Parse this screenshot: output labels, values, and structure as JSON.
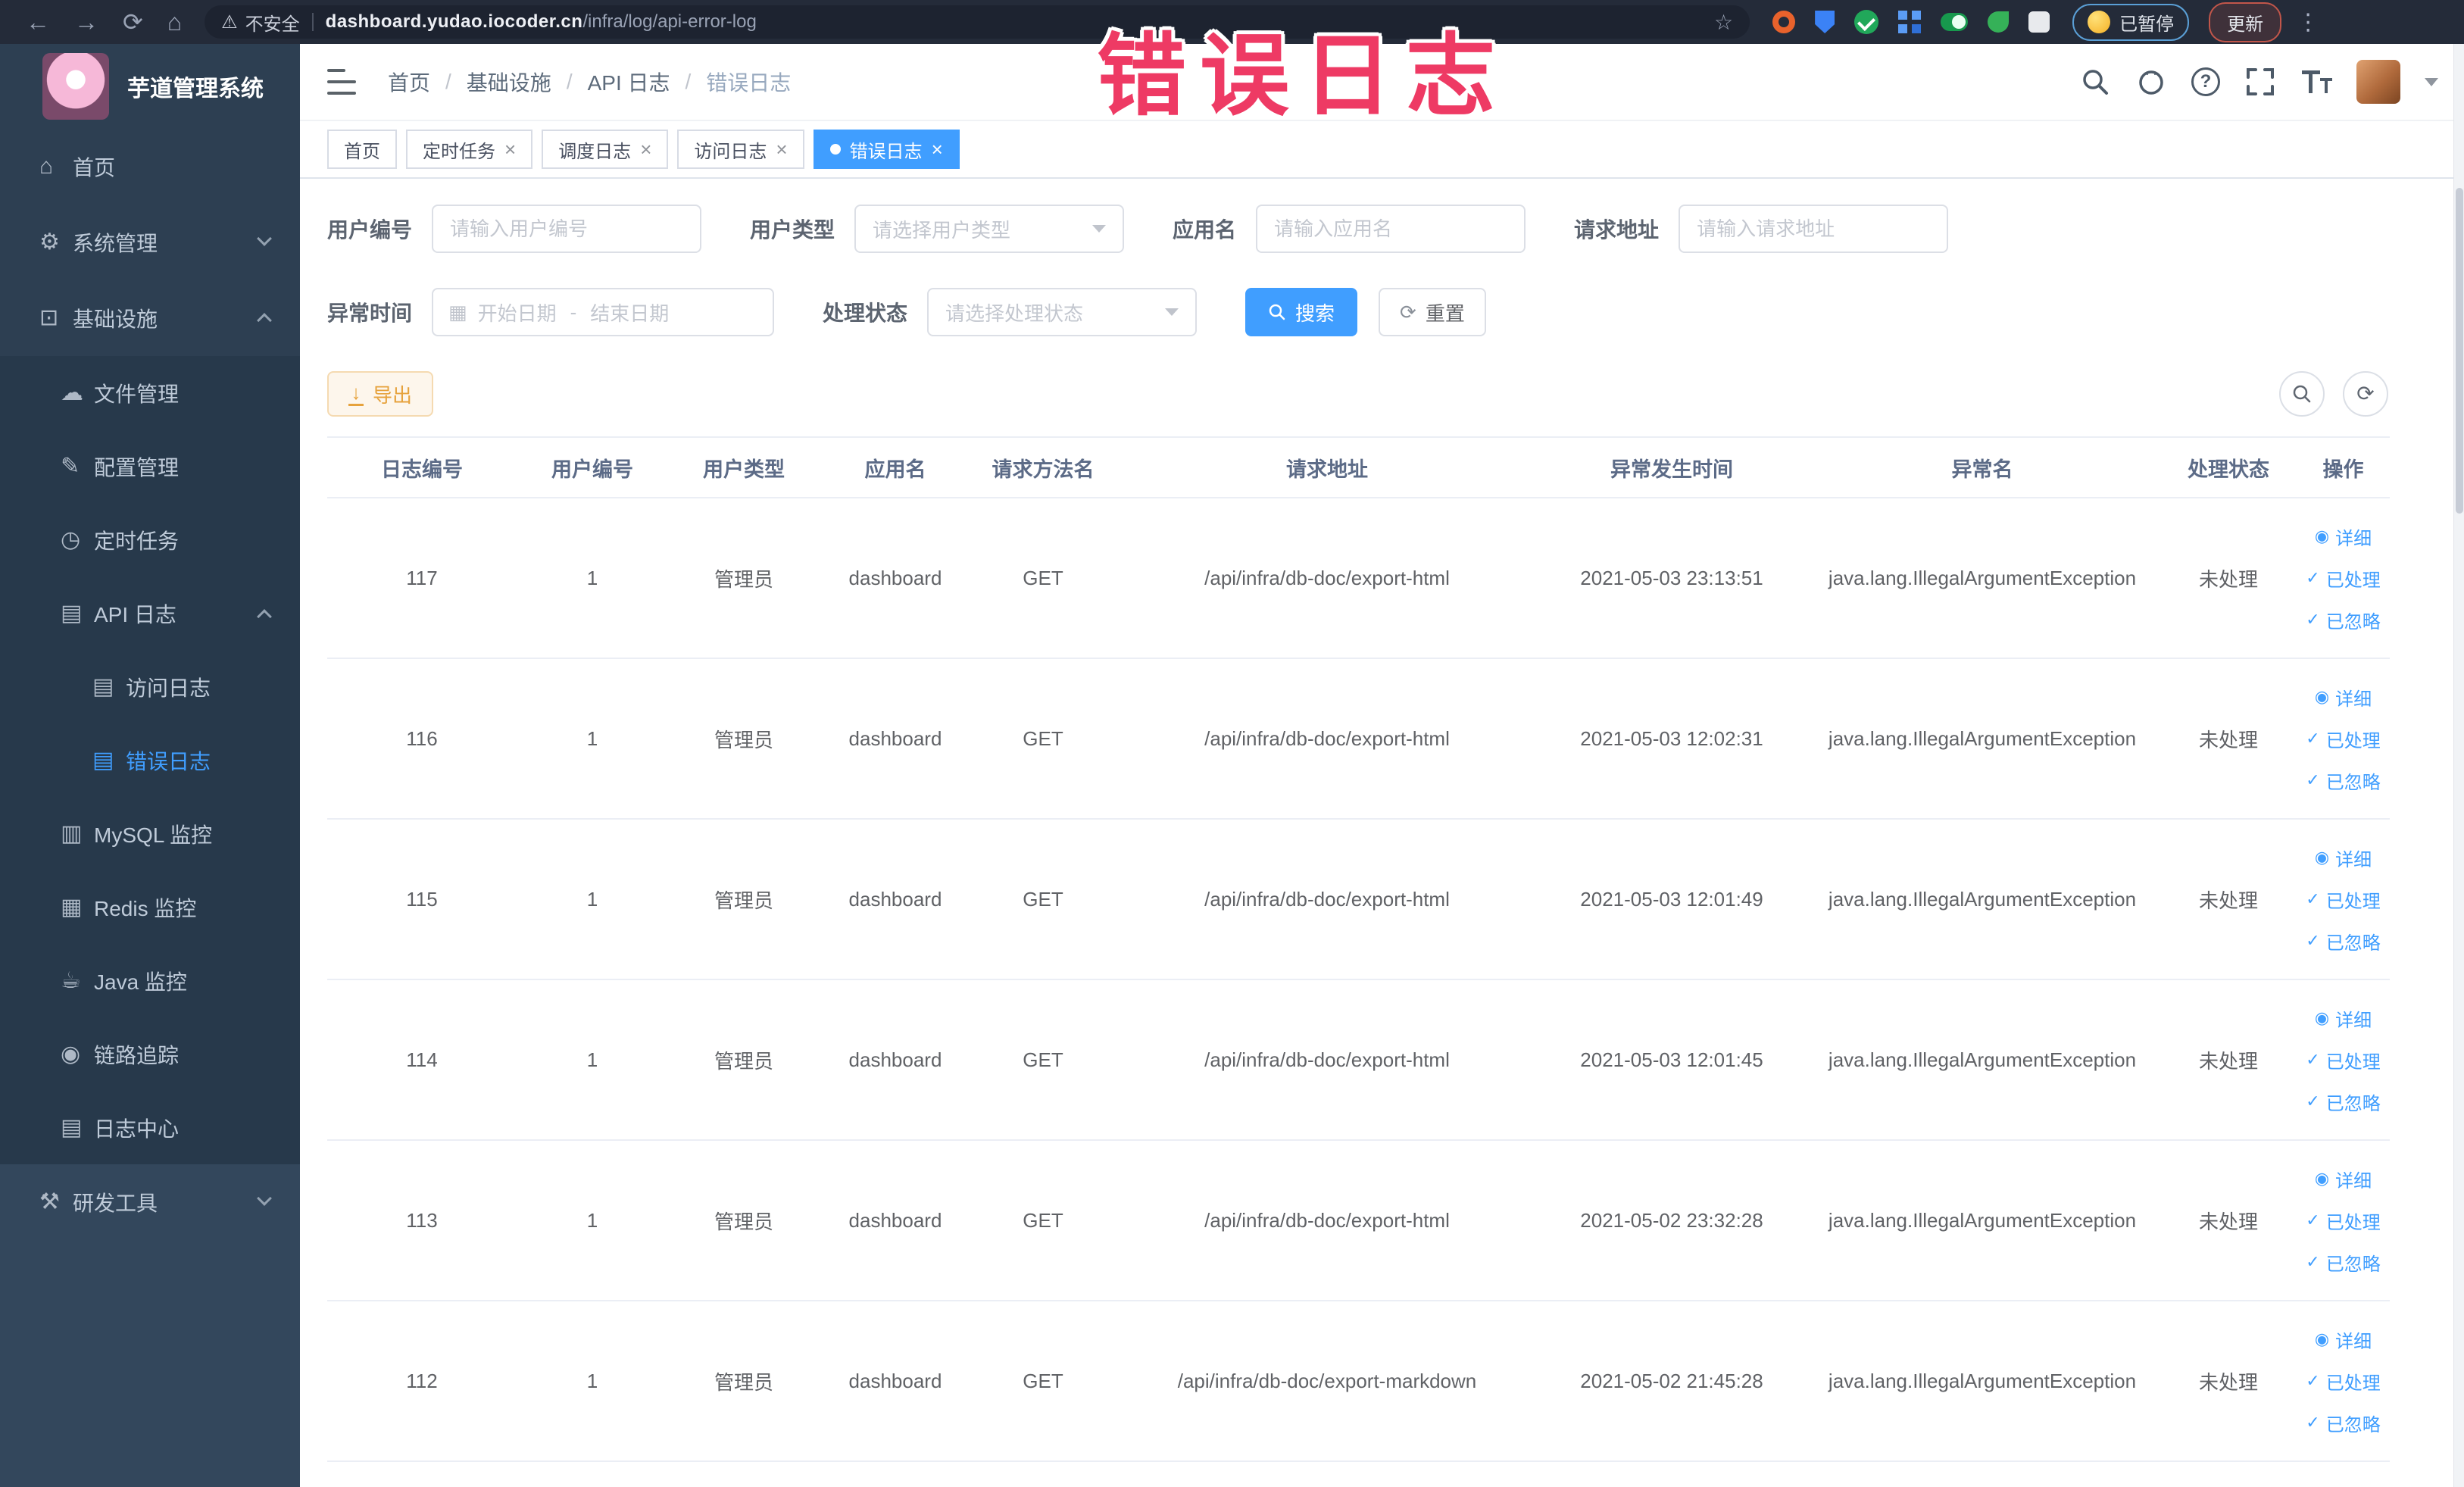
{
  "colors": {
    "accent": "#409eff",
    "sidebar_bg": "#2d3f52",
    "sidebar_submenu_bg": "#27394b",
    "active_menu_text": "#409eff",
    "export_button_bg": "#fdf6ec",
    "export_button_text": "#e6a23c",
    "annotation_pink": "#ee3a64",
    "active_tab_bg": "#409eff"
  },
  "icons": {
    "back": "←",
    "forward": "→",
    "reload": "⟳",
    "home": "⌂",
    "warning": "⚠",
    "star": "☆",
    "kebab": "⋮",
    "help": "?",
    "close": "×",
    "calendar": "▦",
    "reset": "⟳",
    "refresh": "⟳",
    "view": "◉",
    "check": "✓",
    "download": "↓"
  },
  "browser": {
    "security_label": "不安全",
    "url_domain": "dashboard.yudao.iocoder.cn",
    "url_path": "/infra/log/api-error-log",
    "paused_badge": "已暂停",
    "update_button": "更新"
  },
  "annotation": {
    "text": "错误日志"
  },
  "sidebar": {
    "logo_title": "芋道管理系统",
    "items": [
      {
        "icon": "⌂",
        "label": "首页"
      },
      {
        "icon": "⚙",
        "label": "系统管理",
        "expanded": false
      },
      {
        "icon": "⊡",
        "label": "基础设施",
        "expanded": true
      },
      {
        "icon": "☁",
        "label": "文件管理"
      },
      {
        "icon": "✎",
        "label": "配置管理"
      },
      {
        "icon": "◷",
        "label": "定时任务"
      },
      {
        "icon": "▤",
        "label": "API 日志",
        "expanded": true
      },
      {
        "icon": "▤",
        "label": "访问日志"
      },
      {
        "icon": "▤",
        "label": "错误日志",
        "active": true
      },
      {
        "icon": "▥",
        "label": "MySQL 监控"
      },
      {
        "icon": "▦",
        "label": "Redis 监控"
      },
      {
        "icon": "☕",
        "label": "Java 监控"
      },
      {
        "icon": "◉",
        "label": "链路追踪"
      },
      {
        "icon": "▤",
        "label": "日志中心"
      },
      {
        "icon": "⚒",
        "label": "研发工具",
        "expanded": false
      }
    ]
  },
  "breadcrumb": {
    "separator": "/",
    "items": [
      "首页",
      "基础设施",
      "API 日志",
      "错误日志"
    ]
  },
  "tabs": [
    {
      "label": "首页",
      "closable": false,
      "active": false
    },
    {
      "label": "定时任务",
      "closable": true,
      "active": false
    },
    {
      "label": "调度日志",
      "closable": true,
      "active": false
    },
    {
      "label": "访问日志",
      "closable": true,
      "active": false
    },
    {
      "label": "错误日志",
      "closable": true,
      "active": true
    }
  ],
  "filters": {
    "user_id": {
      "label": "用户编号",
      "placeholder": "请输入用户编号",
      "value": ""
    },
    "user_type": {
      "label": "用户类型",
      "placeholder": "请选择用户类型"
    },
    "app_name": {
      "label": "应用名",
      "placeholder": "请输入应用名",
      "value": ""
    },
    "request_url": {
      "label": "请求地址",
      "placeholder": "请输入请求地址",
      "value": ""
    },
    "exception_time": {
      "label": "异常时间",
      "start_placeholder": "开始日期",
      "separator": "-",
      "end_placeholder": "结束日期"
    },
    "process_status": {
      "label": "处理状态",
      "placeholder": "请选择处理状态"
    },
    "search_button": "搜索",
    "reset_button": "重置"
  },
  "toolbar": {
    "export_button": "导出"
  },
  "table": {
    "columns": [
      "日志编号",
      "用户编号",
      "用户类型",
      "应用名",
      "请求方法名",
      "请求地址",
      "异常发生时间",
      "异常名",
      "处理状态",
      "操作"
    ],
    "actions": {
      "detail": "详细",
      "processed": "已处理",
      "ignored": "已忽略"
    },
    "rows": [
      {
        "id": "117",
        "user_id": "1",
        "user_type": "管理员",
        "app": "dashboard",
        "method": "GET",
        "url": "/api/infra/db-doc/export-html",
        "time": "2021-05-03 23:13:51",
        "exception": "java.lang.IllegalArgumentException",
        "status": "未处理"
      },
      {
        "id": "116",
        "user_id": "1",
        "user_type": "管理员",
        "app": "dashboard",
        "method": "GET",
        "url": "/api/infra/db-doc/export-html",
        "time": "2021-05-03 12:02:31",
        "exception": "java.lang.IllegalArgumentException",
        "status": "未处理"
      },
      {
        "id": "115",
        "user_id": "1",
        "user_type": "管理员",
        "app": "dashboard",
        "method": "GET",
        "url": "/api/infra/db-doc/export-html",
        "time": "2021-05-03 12:01:49",
        "exception": "java.lang.IllegalArgumentException",
        "status": "未处理"
      },
      {
        "id": "114",
        "user_id": "1",
        "user_type": "管理员",
        "app": "dashboard",
        "method": "GET",
        "url": "/api/infra/db-doc/export-html",
        "time": "2021-05-03 12:01:45",
        "exception": "java.lang.IllegalArgumentException",
        "status": "未处理"
      },
      {
        "id": "113",
        "user_id": "1",
        "user_type": "管理员",
        "app": "dashboard",
        "method": "GET",
        "url": "/api/infra/db-doc/export-html",
        "time": "2021-05-02 23:32:28",
        "exception": "java.lang.IllegalArgumentException",
        "status": "未处理"
      },
      {
        "id": "112",
        "user_id": "1",
        "user_type": "管理员",
        "app": "dashboard",
        "method": "GET",
        "url": "/api/infra/db-doc/export-markdown",
        "time": "2021-05-02 21:45:28",
        "exception": "java.lang.IllegalArgumentException",
        "status": "未处理"
      }
    ]
  }
}
